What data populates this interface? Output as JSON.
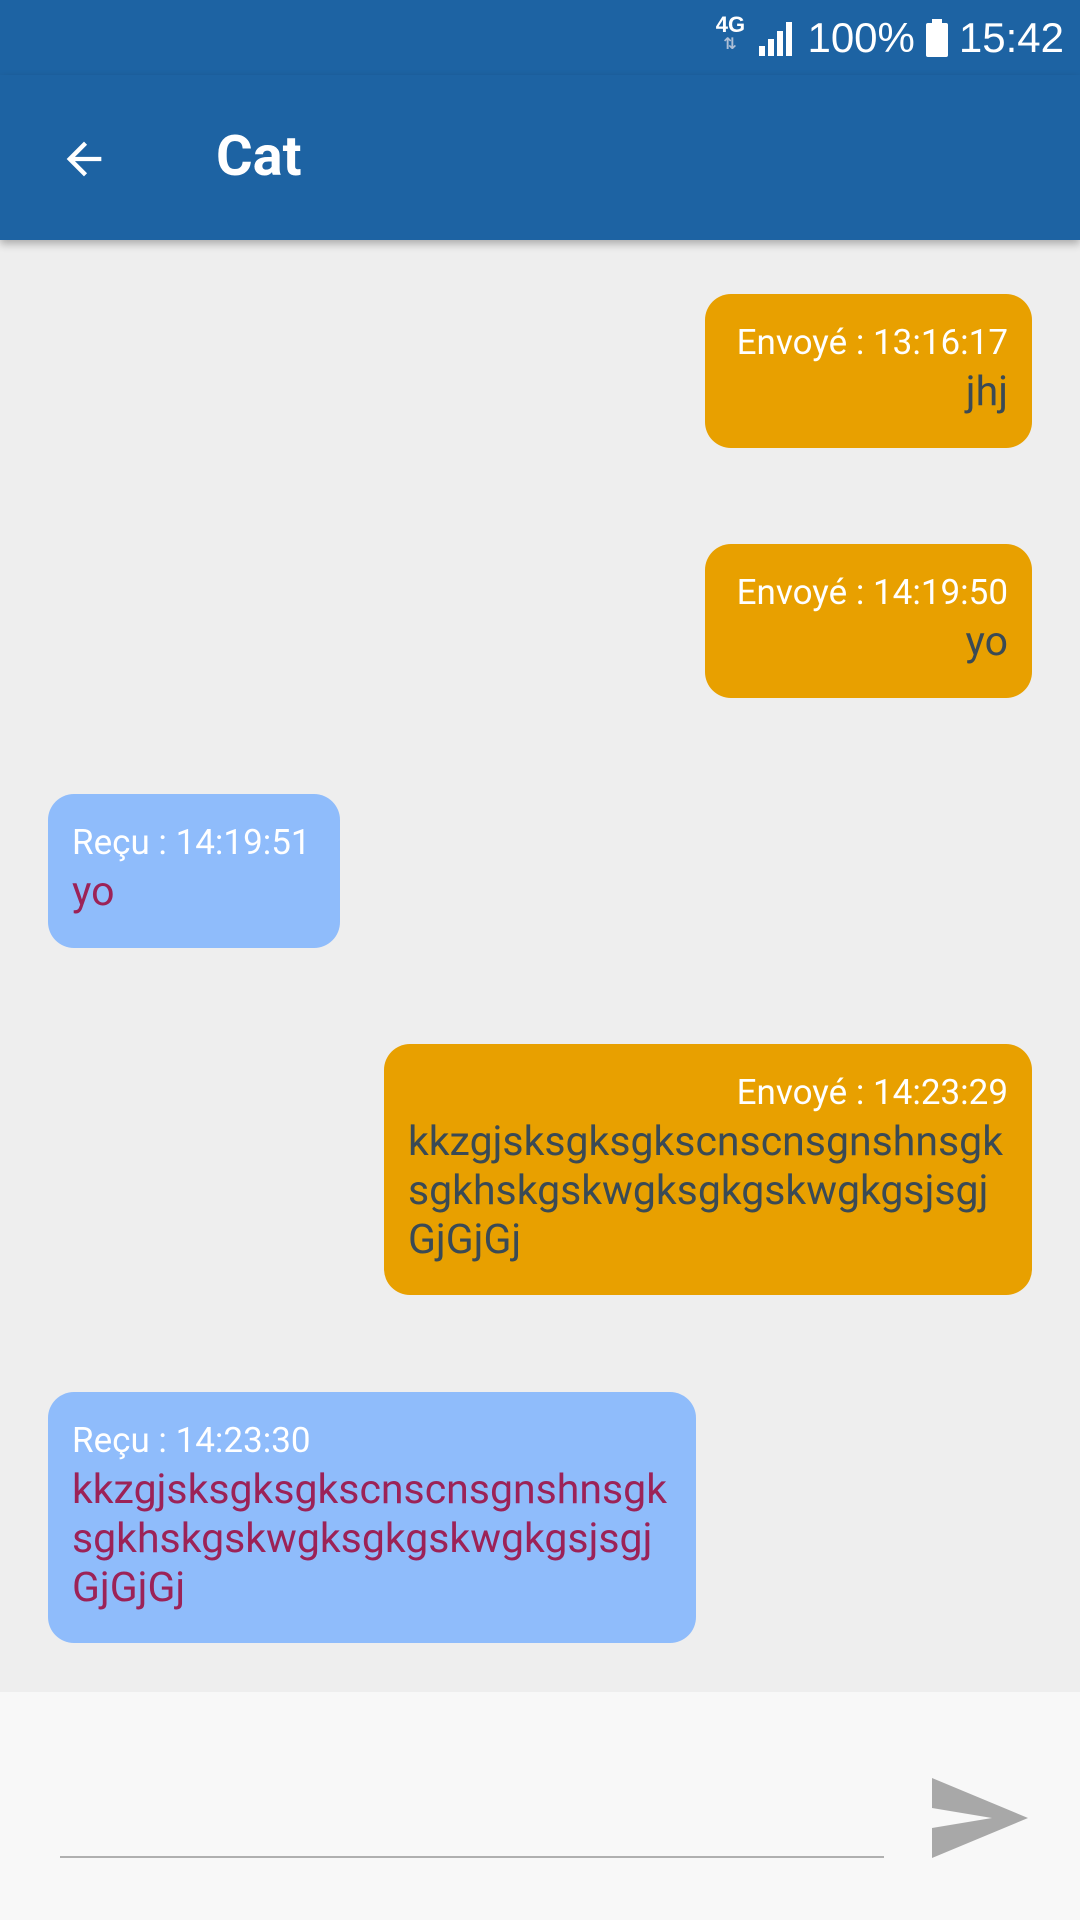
{
  "status_bar": {
    "network_type": "4G",
    "network_arrows": "⇅",
    "battery_percent": "100%",
    "time": "15:42",
    "icons": [
      "signal-icon",
      "battery-icon"
    ]
  },
  "app_bar": {
    "title": "Cat",
    "back_icon": "arrow-back-icon"
  },
  "messages": [
    {
      "direction": "sent",
      "meta": "Envoyé : 13:16:17",
      "text": "jhj"
    },
    {
      "direction": "sent",
      "meta": "Envoyé : 14:19:50",
      "text": "yo"
    },
    {
      "direction": "received",
      "meta": "Reçu : 14:19:51",
      "text": "yo"
    },
    {
      "direction": "sent",
      "meta": "Envoyé : 14:23:29",
      "text": "kkzgjsksgksgkscnscnsgnshnsgksgkhskgskwgksgkgskwgkgsjsgjGjGjGj"
    },
    {
      "direction": "received",
      "meta": "Reçu : 14:23:30",
      "text": "kkzgjsksgksgkscnscnsgnshnsgksgkhskgskwgksgkgskwgkgsjsgjGjGjGj"
    }
  ],
  "composer": {
    "input_value": "",
    "input_placeholder": "",
    "send_icon": "send-icon"
  },
  "colors": {
    "app_bar": "#1d63a3",
    "background": "#eeeeee",
    "sent_bubble": "#e8a000",
    "received_bubble": "#8fbcfb",
    "sent_text": "#3a4a55",
    "received_text": "#9c2257",
    "send_icon": "#a8a8a8"
  }
}
